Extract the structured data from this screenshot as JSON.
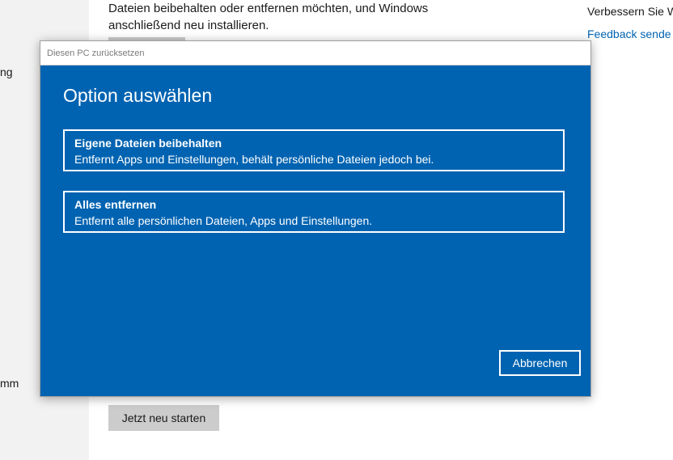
{
  "background": {
    "left_nav": {
      "fragment_top": "ng",
      "fragment_bottom": "mm"
    },
    "main": {
      "text_line1": "Dateien beibehalten oder entfernen möchten, und Windows",
      "text_line2": "anschließend neu installieren.",
      "restart_button": "Jetzt neu starten"
    },
    "right": {
      "improve_text": "Verbessern Sie W",
      "feedback_link": "Feedback sende"
    }
  },
  "dialog": {
    "title": "Diesen PC zurücksetzen",
    "heading": "Option auswählen",
    "options": [
      {
        "title": "Eigene Dateien beibehalten",
        "description": "Entfernt Apps und Einstellungen, behält persönliche Dateien jedoch bei."
      },
      {
        "title": "Alles entfernen",
        "description": "Entfernt alle persönlichen Dateien, Apps und Einstellungen."
      }
    ],
    "cancel_label": "Abbrechen"
  },
  "colors": {
    "dialog_blue": "#0063b1",
    "link_blue": "#0063b1",
    "nav_bg": "#f2f2f2",
    "button_gray": "#cccccc"
  }
}
